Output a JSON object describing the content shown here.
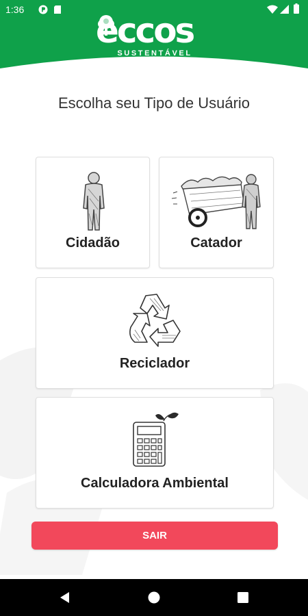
{
  "status_bar": {
    "time": "1:36",
    "icons": [
      "app-notification-icon",
      "sd-card-icon",
      "wifi-icon",
      "signal-icon",
      "battery-icon"
    ]
  },
  "header": {
    "logo_text": "eccos",
    "logo_subtitle": "SUSTENTÁVEL",
    "background_color": "#0fa14a"
  },
  "page": {
    "title": "Escolha seu Tipo de Usuário"
  },
  "options": [
    {
      "label": "Cidadão",
      "icon": "person-icon"
    },
    {
      "label": "Catador",
      "icon": "cart-collector-icon"
    },
    {
      "label": "Reciclador",
      "icon": "recycle-icon"
    },
    {
      "label": "Calculadora Ambiental",
      "icon": "calculator-leaf-icon"
    }
  ],
  "actions": {
    "exit_label": "SAIR",
    "exit_color": "#f2485b"
  },
  "nav_bar": {
    "buttons": [
      "back-icon",
      "home-icon",
      "recents-icon"
    ]
  }
}
